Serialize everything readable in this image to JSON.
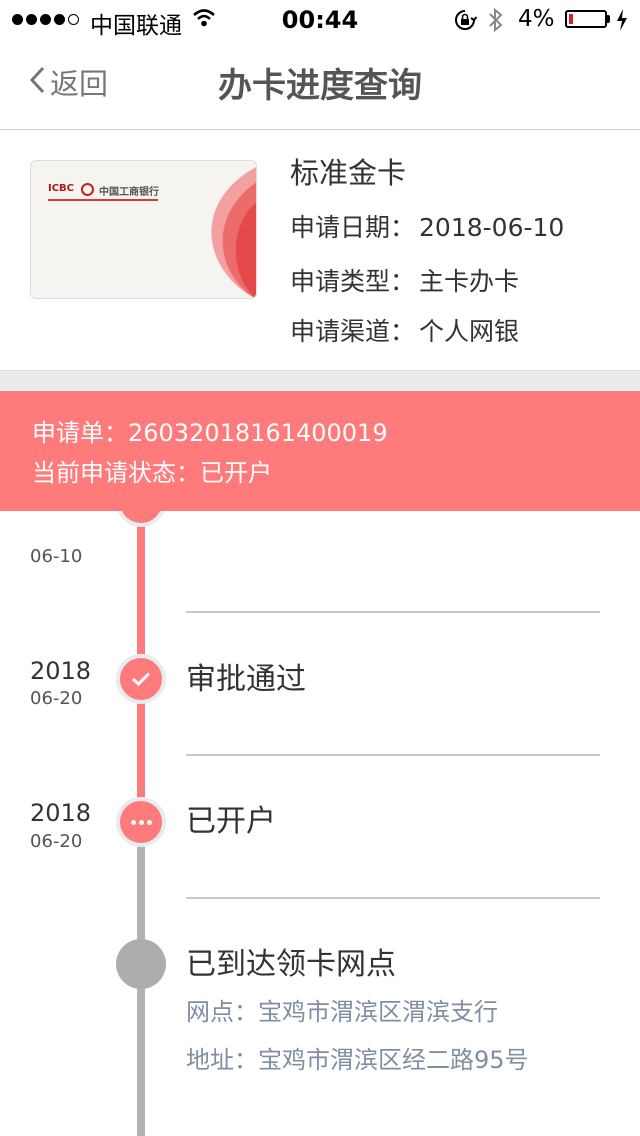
{
  "status_bar": {
    "carrier": "中国联通",
    "time": "00:44",
    "battery": "4%",
    "battery_level": 0.04
  },
  "nav": {
    "back_label": "返回",
    "title": "办卡进度查询"
  },
  "card": {
    "image_logo_en": "ICBC",
    "image_logo_cn": "中国工商银行",
    "name": "标准金卡",
    "apply_date_label": "申请日期：",
    "apply_date": "2018-06-10",
    "apply_type_label": "申请类型：",
    "apply_type": "主卡办卡",
    "apply_channel_label": "申请渠道：",
    "apply_channel": "个人网银"
  },
  "banner": {
    "order_label": "申请单：",
    "order_no": "26032018161400019",
    "status_label": "当前申请状态：",
    "status": "已开户"
  },
  "timeline": {
    "first_date": "06-10",
    "steps": [
      {
        "year": "2018",
        "date": "06-20",
        "title": "审批通过",
        "state": "done"
      },
      {
        "year": "2018",
        "date": "06-20",
        "title": "已开户",
        "state": "current"
      },
      {
        "year": "",
        "date": "",
        "title": "已到达领卡网点",
        "state": "pending"
      }
    ],
    "branch_label": "网点：",
    "branch": "宝鸡市渭滨区渭滨支行",
    "address_label": "地址：",
    "address": "宝鸡市渭滨区经二路95号"
  },
  "colors": {
    "accent": "#ff7a7a",
    "pending": "#adadad",
    "detail_text": "#7f8fa3"
  },
  "icons": [
    "wifi-icon",
    "rotation-lock-icon",
    "bluetooth-icon",
    "charging-icon",
    "chevron-left-icon",
    "check-icon",
    "ellipsis-icon"
  ]
}
